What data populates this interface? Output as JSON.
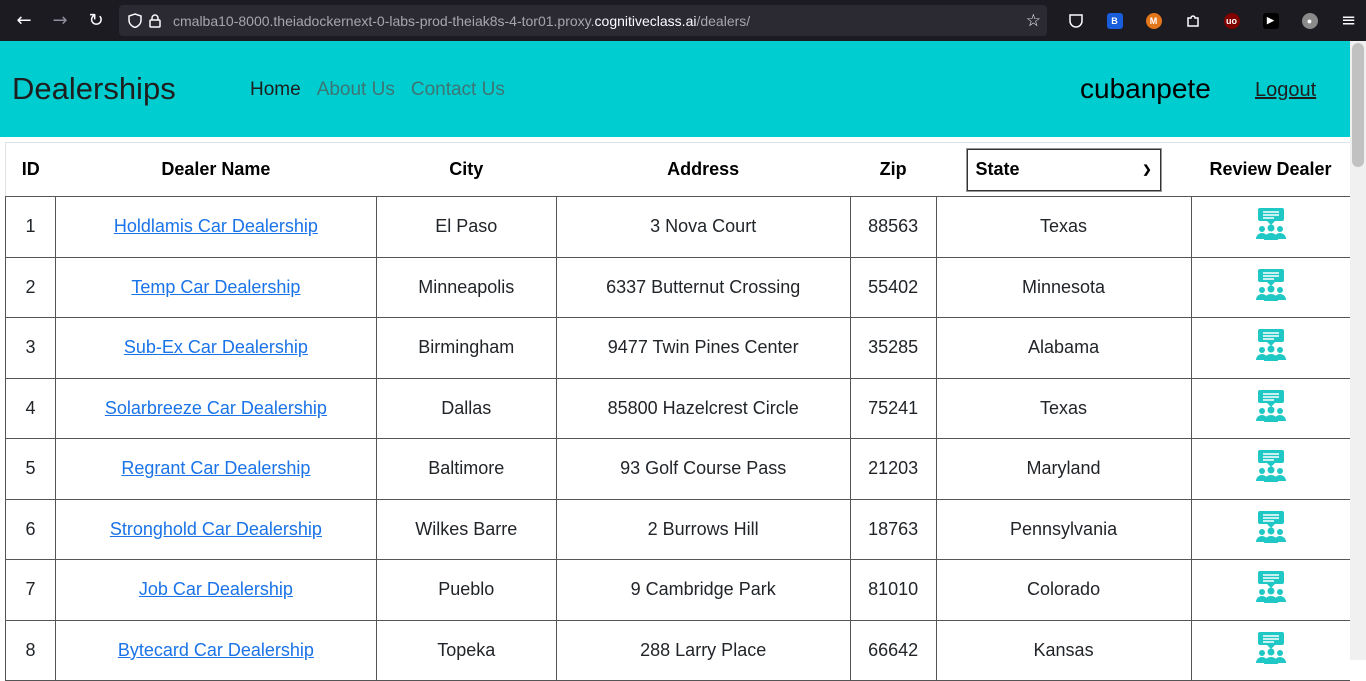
{
  "browser": {
    "url_prefix": "cmalba10-8000.theiadockernext-0-labs-prod-theiak8s-4-tor01.proxy.",
    "url_domain": "cognitiveclass.ai",
    "url_suffix": "/dealers/"
  },
  "navbar": {
    "brand": "Dealerships",
    "links": [
      "Home",
      "About Us",
      "Contact Us"
    ],
    "username": "cubanpete",
    "logout": "Logout",
    "bg_color": "#00cdd0"
  },
  "table": {
    "headers": [
      "ID",
      "Dealer Name",
      "City",
      "Address",
      "Zip",
      "Review Dealer"
    ],
    "state_select": "State",
    "rows": [
      {
        "id": "1",
        "name": "Holdlamis Car Dealership",
        "city": "El Paso",
        "address": "3 Nova Court",
        "zip": "88563",
        "state": "Texas"
      },
      {
        "id": "2",
        "name": "Temp Car Dealership",
        "city": "Minneapolis",
        "address": "6337 Butternut Crossing",
        "zip": "55402",
        "state": "Minnesota"
      },
      {
        "id": "3",
        "name": "Sub-Ex Car Dealership",
        "city": "Birmingham",
        "address": "9477 Twin Pines Center",
        "zip": "35285",
        "state": "Alabama"
      },
      {
        "id": "4",
        "name": "Solarbreeze Car Dealership",
        "city": "Dallas",
        "address": "85800 Hazelcrest Circle",
        "zip": "75241",
        "state": "Texas"
      },
      {
        "id": "5",
        "name": "Regrant Car Dealership",
        "city": "Baltimore",
        "address": "93 Golf Course Pass",
        "zip": "21203",
        "state": "Maryland"
      },
      {
        "id": "6",
        "name": "Stronghold Car Dealership",
        "city": "Wilkes Barre",
        "address": "2 Burrows Hill",
        "zip": "18763",
        "state": "Pennsylvania"
      },
      {
        "id": "7",
        "name": "Job Car Dealership",
        "city": "Pueblo",
        "address": "9 Cambridge Park",
        "zip": "81010",
        "state": "Colorado"
      },
      {
        "id": "8",
        "name": "Bytecard Car Dealership",
        "city": "Topeka",
        "address": "288 Larry Place",
        "zip": "66642",
        "state": "Kansas"
      }
    ]
  }
}
